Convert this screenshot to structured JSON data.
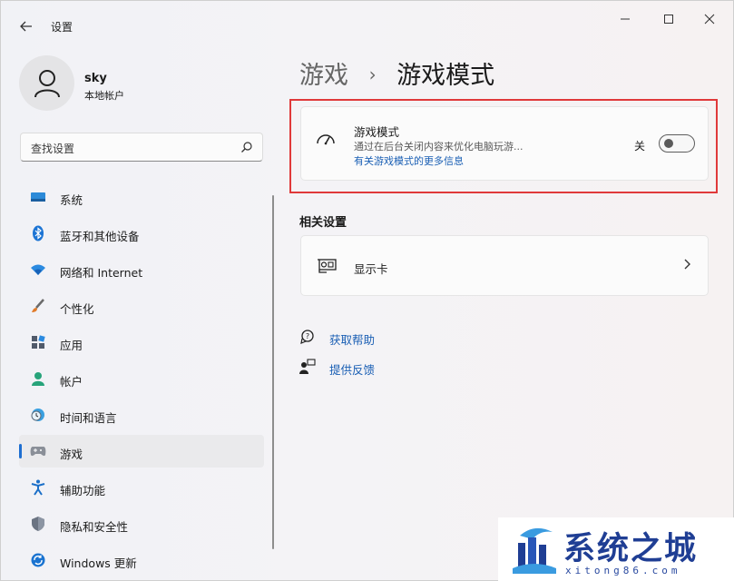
{
  "window": {
    "title": "设置",
    "back": "←"
  },
  "profile": {
    "name": "sky",
    "account_type": "本地帐户"
  },
  "search": {
    "placeholder": "查找设置"
  },
  "sidebar": {
    "items": [
      {
        "label": "系统",
        "icon": "system-icon"
      },
      {
        "label": "蓝牙和其他设备",
        "icon": "bluetooth-icon"
      },
      {
        "label": "网络和 Internet",
        "icon": "wifi-icon"
      },
      {
        "label": "个性化",
        "icon": "brush-icon"
      },
      {
        "label": "应用",
        "icon": "apps-icon"
      },
      {
        "label": "帐户",
        "icon": "person-icon"
      },
      {
        "label": "时间和语言",
        "icon": "globe-clock-icon"
      },
      {
        "label": "游戏",
        "icon": "gamepad-icon",
        "selected": true
      },
      {
        "label": "辅助功能",
        "icon": "accessibility-icon"
      },
      {
        "label": "隐私和安全性",
        "icon": "shield-icon"
      },
      {
        "label": "Windows 更新",
        "icon": "update-icon"
      }
    ]
  },
  "breadcrumb": {
    "parent": "游戏",
    "separator": "›",
    "current": "游戏模式"
  },
  "game_mode": {
    "title": "游戏模式",
    "description": "通过在后台关闭内容来优化电脑玩游...",
    "link": "有关游戏模式的更多信息",
    "toggle_state": "关"
  },
  "related": {
    "heading": "相关设置",
    "graphics_label": "显示卡"
  },
  "links": {
    "help": "获取帮助",
    "feedback": "提供反馈"
  },
  "watermark": {
    "title": "系统之城",
    "url": "xitong86.com"
  },
  "colors": {
    "accent": "#1e6fd1",
    "link": "#1a5fb4",
    "highlight": "#e0393a"
  }
}
